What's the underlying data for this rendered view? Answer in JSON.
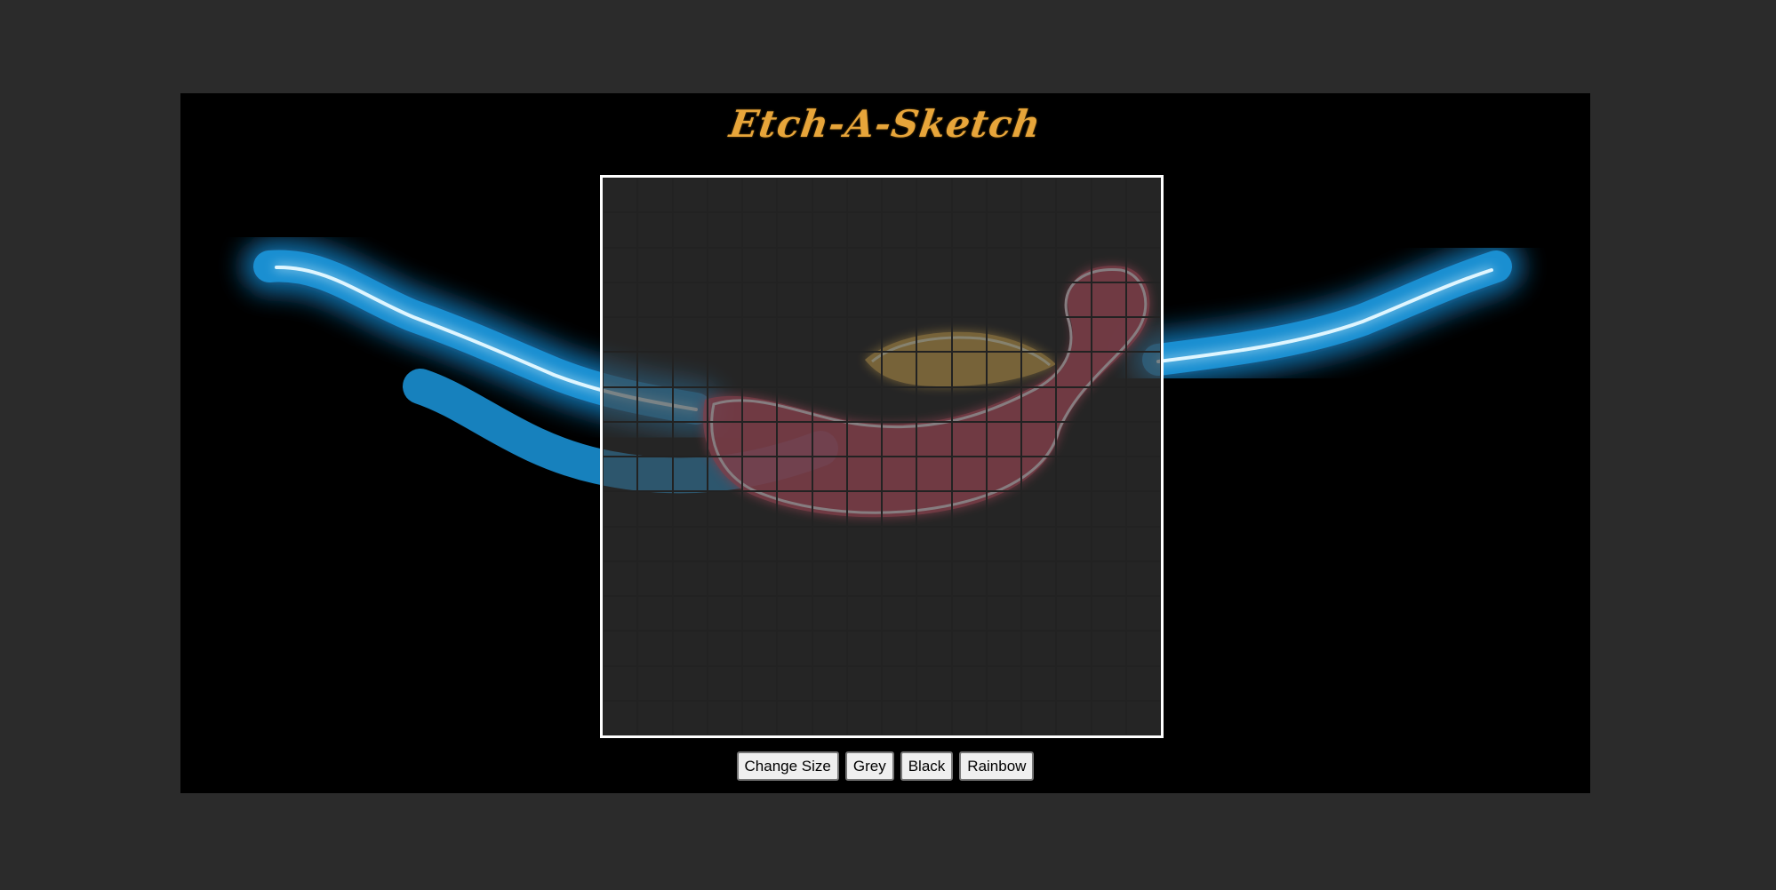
{
  "app": {
    "title": "Etch-A-Sketch"
  },
  "grid": {
    "rows": 16,
    "cols": 16
  },
  "controls": {
    "change_size_label": "Change Size",
    "grey_label": "Grey",
    "black_label": "Black",
    "rainbow_label": "Rainbow"
  },
  "colors": {
    "page_background": "#2b2b2b",
    "stage_background": "#000000",
    "title": "#e7a53a",
    "cell_fill": "#3d3d3d",
    "cell_border": "#222222",
    "board_border": "#ffffff",
    "neon_blue": "#1a8fd1",
    "neon_pink": "#e8435f",
    "neon_yellow": "#f0b43a"
  },
  "background_image": {
    "icon": "neon-swimmer-icon"
  }
}
